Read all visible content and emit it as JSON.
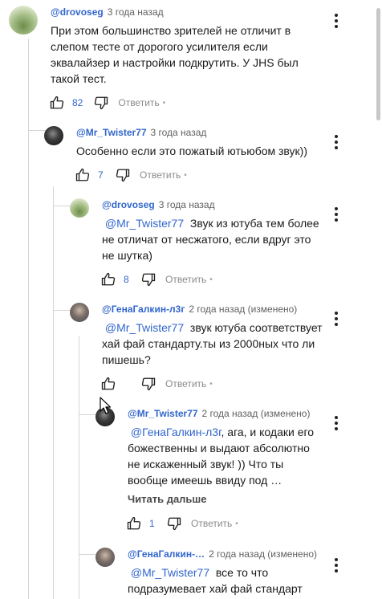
{
  "comments": [
    {
      "author": "@drovoseg",
      "time": "3 года назад",
      "text": "При этом большинство зрителей не отличит в слепом тесте от дорогого усилителя если эквалайзер и настройки подкрутить. У JHS был такой тест.",
      "likes": "82",
      "reply_label": "Ответить",
      "reply_dot": "•"
    },
    {
      "author": "@Mr_Twister77",
      "time": "3 года назад",
      "text": "Особенно если это пожатый ютьюбом звук))",
      "likes": "7",
      "reply_label": "Ответить",
      "reply_dot": "•"
    },
    {
      "author": "@drovoseg",
      "time": "3 года назад",
      "mention": "@Mr_Twister77",
      "text": "Звук из ютуба тем более не отличат от несжатого, если вдруг это не шутка)",
      "likes": "8",
      "reply_label": "Ответить",
      "reply_dot": "•"
    },
    {
      "author": "@ГенаГалкин-л3г",
      "time": "2 года назад (изменено)",
      "mention": "@Mr_Twister77",
      "text": "звук ютуба соответствует хай фай стандарту.ты из 2000ных что ли пишешь?",
      "likes": "",
      "reply_label": "Ответить",
      "reply_dot": "•"
    },
    {
      "author": "@Mr_Twister77",
      "time": "2 года назад (изменено)",
      "mention": "@ГенаГалкин-л3г",
      "text": ", ага, и кодаки его божественны и выдают абсолютно не искаженный звук! )) Что ты вообще имеешь ввиду под …",
      "read_more": "Читать дальше",
      "likes": "1",
      "reply_label": "Ответить",
      "reply_dot": "•"
    },
    {
      "author": "@ГенаГалкин-…",
      "time": "2 года назад (изменено)",
      "mention": "@Mr_Twister77",
      "text": "все то что подразумевает хай фай стандарт"
    }
  ],
  "icons": {
    "like": "thumb-up-icon",
    "dislike": "thumb-down-icon",
    "menu": "more-vertical-icon",
    "cursor": "mouse-pointer-icon"
  },
  "colors": {
    "author": "#3166cc",
    "likes": "#3166cc",
    "text": "#1a1a1a",
    "meta": "#606060",
    "thread_line": "#d5d5d5"
  }
}
